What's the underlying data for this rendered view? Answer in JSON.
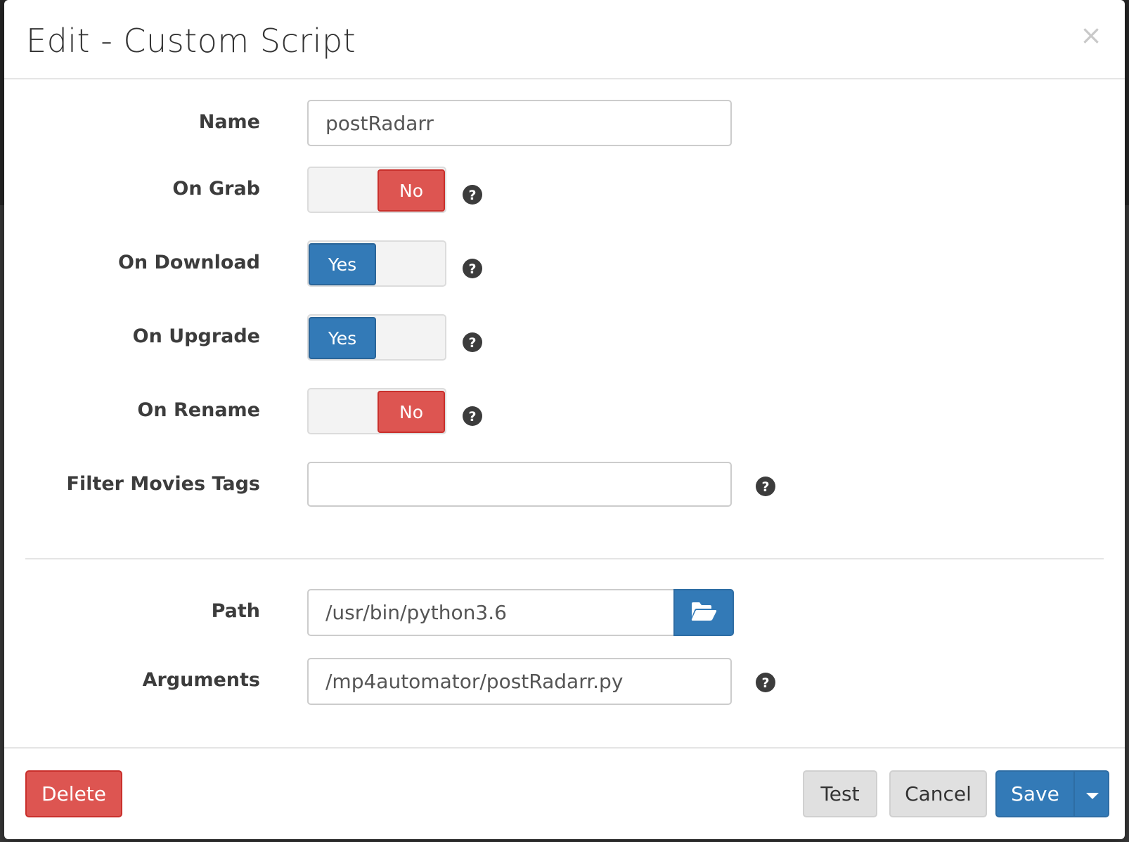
{
  "modal": {
    "title": "Edit - Custom Script",
    "close_label": "×"
  },
  "form": {
    "name": {
      "label": "Name",
      "value": "postRadarr"
    },
    "on_grab": {
      "label": "On Grab",
      "value": "No",
      "enabled": false
    },
    "on_download": {
      "label": "On Download",
      "value": "Yes",
      "enabled": true
    },
    "on_upgrade": {
      "label": "On Upgrade",
      "value": "Yes",
      "enabled": true
    },
    "on_rename": {
      "label": "On Rename",
      "value": "No",
      "enabled": false
    },
    "filter_movies_tags": {
      "label": "Filter Movies Tags",
      "value": ""
    },
    "path": {
      "label": "Path",
      "value": "/usr/bin/python3.6"
    },
    "arguments": {
      "label": "Arguments",
      "value": "/mp4automator/postRadarr.py"
    }
  },
  "footer": {
    "delete_label": "Delete",
    "test_label": "Test",
    "cancel_label": "Cancel",
    "save_label": "Save"
  },
  "colors": {
    "primary": "#337ab7",
    "danger": "#dd5551",
    "default": "#e0e0e0"
  },
  "icons": {
    "help": "question-circle-icon",
    "folder": "folder-open-icon",
    "close": "close-icon",
    "caret": "caret-down-icon"
  }
}
